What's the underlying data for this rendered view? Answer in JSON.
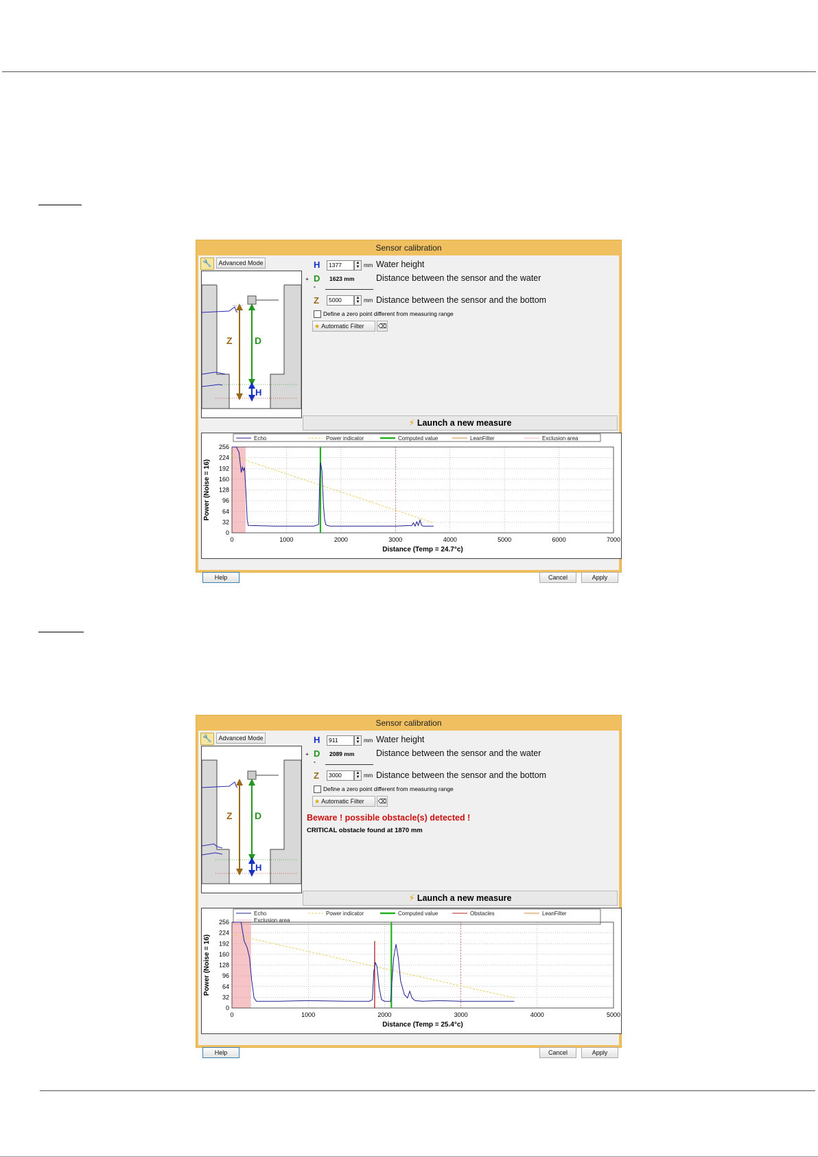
{
  "dialogs": [
    {
      "title": "Sensor calibration",
      "advanced_mode": "Advanced Mode",
      "h": {
        "letter": "H",
        "value": "1377",
        "unit": "mm",
        "label": "Water height"
      },
      "d": {
        "sign": "+",
        "letter": "D",
        "value": "1623 mm",
        "label": "Distance between the sensor and the water"
      },
      "minus": "-",
      "z": {
        "letter": "Z",
        "value": "5000",
        "unit": "mm",
        "label": "Distance between the sensor and the bottom"
      },
      "zero_point_label": "Define a zero point different from measuring range",
      "zero_point_checked": false,
      "automatic_filter": "Automatic Filter",
      "warning": "",
      "critical": "",
      "launch": "Launch a new measure",
      "help": "Help",
      "cancel": "Cancel",
      "apply": "Apply",
      "diagram": {
        "z": "Z",
        "d": "D",
        "h": "H"
      }
    },
    {
      "title": "Sensor calibration",
      "advanced_mode": "Advanced Mode",
      "h": {
        "letter": "H",
        "value": "911",
        "unit": "mm",
        "label": "Water height"
      },
      "d": {
        "sign": "+",
        "letter": "D",
        "value": "2089 mm",
        "label": "Distance between the sensor and the water"
      },
      "minus": "-",
      "z": {
        "letter": "Z",
        "value": "3000",
        "unit": "mm",
        "label": "Distance between the sensor and the bottom"
      },
      "zero_point_label": "Define a zero point different from measuring range",
      "zero_point_checked": false,
      "automatic_filter": "Automatic Filter",
      "warning": "Beware ! possible obstacle(s) detected !",
      "critical": "CRITICAL obstacle found at 1870 mm",
      "launch": "Launch a new measure",
      "help": "Help",
      "cancel": "Cancel",
      "apply": "Apply",
      "diagram": {
        "z": "Z",
        "d": "D",
        "h": "H"
      }
    }
  ],
  "chart_data": [
    {
      "type": "line",
      "xlabel": "Distance (Temp = 24.7°c)",
      "ylabel": "Power (Noise = 16)",
      "xlim": [
        0,
        7000
      ],
      "ylim": [
        0,
        256
      ],
      "xticks": [
        0,
        1000,
        2000,
        3000,
        4000,
        5000,
        6000,
        7000
      ],
      "yticks": [
        0,
        32,
        64,
        96,
        128,
        160,
        192,
        224,
        256
      ],
      "grid": true,
      "legend": [
        "Echo",
        "Power indicator",
        "Computed value",
        "LeanFilter",
        "Exclusion area"
      ],
      "exclusion_area": [
        0,
        250
      ],
      "computed_value": 1623,
      "dashed_marker": 3000,
      "power_indicator": [
        [
          0,
          230
        ],
        [
          3700,
          30
        ]
      ],
      "series": [
        {
          "name": "Echo",
          "x": [
            0,
            80,
            130,
            170,
            190,
            210,
            230,
            260,
            280,
            300,
            800,
            1500,
            1590,
            1610,
            1625,
            1650,
            1680,
            1700,
            1720,
            1750,
            1800,
            2500,
            3000,
            3300,
            3330,
            3360,
            3390,
            3420,
            3450,
            3480,
            3510,
            3700
          ],
          "values": [
            256,
            256,
            240,
            180,
            196,
            186,
            195,
            110,
            40,
            22,
            20,
            20,
            25,
            160,
            210,
            185,
            80,
            40,
            25,
            22,
            20,
            20,
            20,
            22,
            30,
            20,
            33,
            22,
            38,
            22,
            20,
            20
          ]
        }
      ]
    },
    {
      "type": "line",
      "xlabel": "Distance (Temp = 25.4°c)",
      "ylabel": "Power (Noise = 16)",
      "xlim": [
        0,
        5000
      ],
      "ylim": [
        0,
        256
      ],
      "xticks": [
        0,
        1000,
        2000,
        3000,
        4000,
        5000
      ],
      "yticks": [
        0,
        32,
        64,
        96,
        128,
        160,
        192,
        224,
        256
      ],
      "grid": true,
      "legend": [
        "Echo",
        "Power indicator",
        "Computed value",
        "Obstacles",
        "LeanFilter",
        "Exclusion area"
      ],
      "exclusion_area": [
        0,
        250
      ],
      "computed_value": 2089,
      "obstacle": 1870,
      "dashed_marker": 3000,
      "power_indicator": [
        [
          0,
          220
        ],
        [
          3700,
          30
        ]
      ],
      "series": [
        {
          "name": "Echo",
          "x": [
            0,
            120,
            160,
            200,
            230,
            260,
            290,
            320,
            600,
            1000,
            1500,
            1800,
            1840,
            1860,
            1880,
            1900,
            1930,
            1960,
            2000,
            2080,
            2100,
            2120,
            2150,
            2180,
            2210,
            2260,
            2300,
            2330,
            2360,
            2400,
            2500,
            2700,
            3000,
            3500,
            3700
          ],
          "values": [
            256,
            256,
            200,
            180,
            150,
            80,
            30,
            20,
            20,
            22,
            20,
            20,
            25,
            110,
            135,
            125,
            60,
            25,
            20,
            20,
            90,
            150,
            190,
            150,
            80,
            40,
            30,
            50,
            30,
            22,
            20,
            22,
            20,
            20,
            20
          ]
        }
      ]
    }
  ],
  "colors": {
    "dialog_border": "#f0c060",
    "h": "#1530c8",
    "d": "#22961e",
    "z": "#9a6a1a",
    "echo": "#202090",
    "power": "#e8d060",
    "computed": "#22b020",
    "obstacle": "#b02020",
    "exclusion": "#f4b4b8",
    "dashed": "#c06060"
  }
}
